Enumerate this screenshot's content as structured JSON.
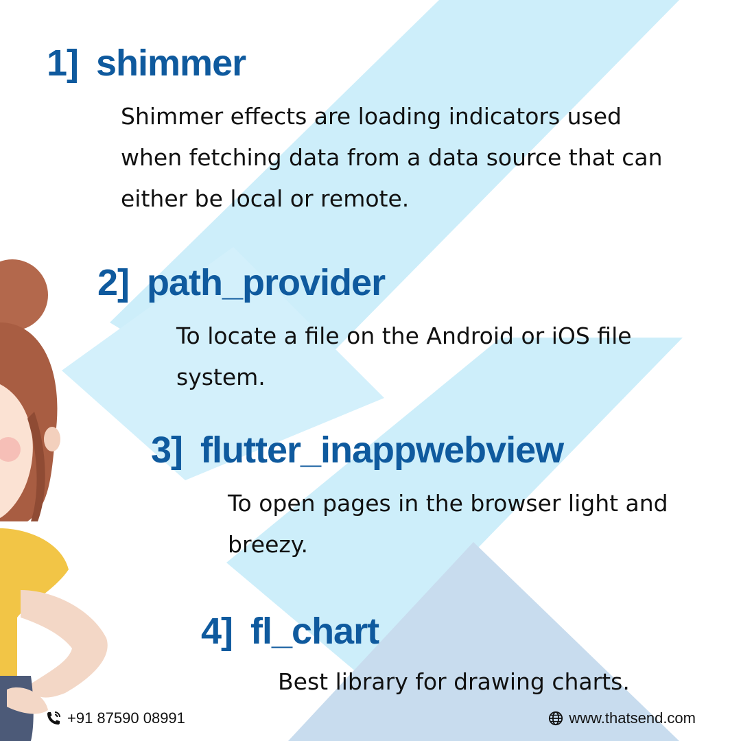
{
  "items": [
    {
      "number": "1]",
      "title": "shimmer",
      "description": "Shimmer effects are loading indicators used when fetching data from a data source that can either be local or remote."
    },
    {
      "number": "2]",
      "title": "path_provider",
      "description": "To locate a file on the Android or iOS file system."
    },
    {
      "number": "3]",
      "title": "flutter_inappwebview",
      "description": "To open pages in the browser light and breezy."
    },
    {
      "number": "4]",
      "title": "fl_chart",
      "description": "Best library for drawing charts."
    }
  ],
  "footer": {
    "phone": "+91 87590 08991",
    "phone_icon": "phone-icon",
    "website": "www.thatsend.com",
    "website_icon": "globe-icon"
  },
  "colors": {
    "title": "#0f5a9e",
    "shape_light": "#cdeefa",
    "shape_dark": "#c8dcee",
    "text": "#111111"
  }
}
